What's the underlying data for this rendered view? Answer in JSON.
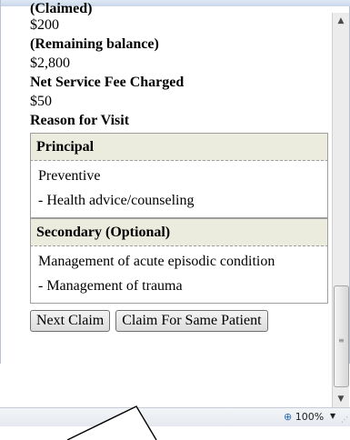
{
  "summary": {
    "claimed_label": "(Claimed)",
    "claimed_value": "$200",
    "remaining_label": "(Remaining balance)",
    "remaining_value": "$2,800",
    "fee_label": "Net Service Fee Charged",
    "fee_value": "$50",
    "reason_label": "Reason for Visit"
  },
  "principal": {
    "heading": "Principal",
    "items": [
      "Preventive",
      "- Health advice/counseling"
    ]
  },
  "secondary": {
    "heading": "Secondary (Optional)",
    "items": [
      "Management of acute episodic condition",
      "- Management of trauma"
    ]
  },
  "buttons": {
    "next_claim": "Next Claim",
    "same_patient": "Claim For Same Patient"
  },
  "statusbar": {
    "zoom": "100%",
    "zoom_icon": "zoom-icon"
  }
}
